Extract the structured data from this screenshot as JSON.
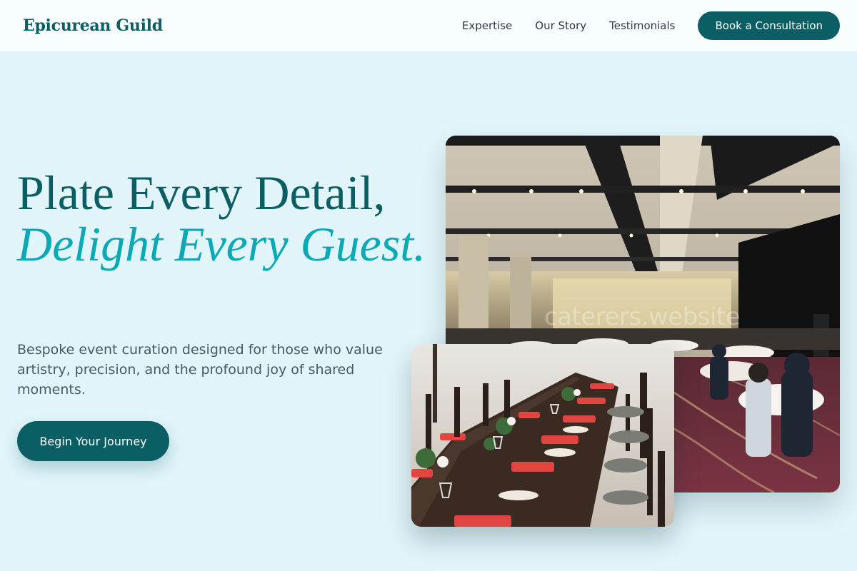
{
  "header": {
    "brand": "Epicurean Guild",
    "nav": [
      "Expertise",
      "Our Story",
      "Testimonials"
    ],
    "cta": "Book a Consultation"
  },
  "hero": {
    "title_line1": "Plate Every Detail,",
    "title_accent": "Delight Every Guest.",
    "description": "Bespoke event curation designed for those who value artistry, precision, and the profound joy of shared moments.",
    "cta": "Begin Your Journey"
  },
  "images": {
    "ballroom_watermark": "caterers.website"
  },
  "colors": {
    "primary": "#0b5e63",
    "accent": "#0aa9b6",
    "background": "#e1f5fa",
    "header_bg": "#f8fdfe"
  }
}
